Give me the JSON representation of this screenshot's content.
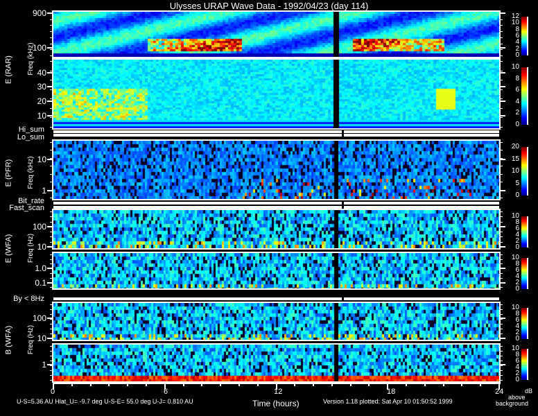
{
  "chart_data": {
    "type": "heatmap",
    "title": "Ulysses URAP Wave Data - 1992/04/23  (day 114)",
    "xlabel": "Time (hours)",
    "xlim": [
      0,
      24
    ],
    "xticks": [
      "0",
      "6",
      "12",
      "18",
      "24"
    ],
    "colorbar_label": [
      "dB",
      "above",
      "background"
    ],
    "colormap": "jet",
    "panels": [
      {
        "id": "rar-high",
        "group_label": "E (RAR)",
        "ylabel": "Freq (kHz)",
        "yscale": "log",
        "ylim": [
          56,
          1000
        ],
        "yticks": [
          {
            "value": 900,
            "label": "900"
          },
          {
            "value": 100,
            "label": "100"
          }
        ],
        "colorbar": {
          "range": [
            0,
            12
          ],
          "ticks": [
            "12",
            "10",
            "8",
            "6",
            "4",
            "2",
            "0"
          ]
        }
      },
      {
        "id": "rar-low",
        "group_label": "",
        "ylabel": "",
        "yscale": "linear",
        "ylim": [
          1.3,
          49
        ],
        "yticks": [
          {
            "value": 40,
            "label": "40"
          },
          {
            "value": 30,
            "label": "30"
          },
          {
            "value": 20,
            "label": "20"
          },
          {
            "value": 10,
            "label": "10"
          }
        ],
        "colorbar": {
          "range": [
            0,
            10
          ],
          "ticks": [
            "10",
            "8",
            "6",
            "4",
            "2",
            "0"
          ]
        }
      },
      {
        "id": "pfr",
        "group_label": "E (PFR)",
        "ylabel": "Freq (kHz)",
        "yscale": "log",
        "ylim": [
          0.54,
          40
        ],
        "yticks": [
          {
            "value": 10,
            "label": "10"
          },
          {
            "value": 1,
            "label": "1"
          }
        ],
        "colorbar": {
          "range": [
            0,
            20
          ],
          "ticks": [
            "20",
            "15",
            "10",
            "5",
            "0"
          ]
        }
      },
      {
        "id": "e-wfa-high",
        "group_label": "E (WFA)",
        "ylabel": "Freq (Hz)",
        "yscale": "log",
        "ylim": [
          8.5,
          670
        ],
        "yticks": [
          {
            "value": 100,
            "label": "100"
          },
          {
            "value": 10,
            "label": "10"
          }
        ],
        "colorbar": {
          "range": [
            0,
            10
          ],
          "ticks": [
            "10",
            "8",
            "6",
            "4",
            "2",
            "0"
          ]
        }
      },
      {
        "id": "e-wfa-low",
        "group_label": "",
        "ylabel": "",
        "yscale": "log",
        "ylim": [
          0.042,
          11
        ],
        "yticks": [
          {
            "value": 1.0,
            "label": "1.0"
          },
          {
            "value": 0.1,
            "label": "0.1"
          }
        ],
        "colorbar": {
          "range": [
            0,
            10
          ],
          "ticks": [
            "10",
            "8",
            "6",
            "4",
            "2",
            "0"
          ]
        }
      },
      {
        "id": "b-wfa-high",
        "group_label": "B (WFA)",
        "ylabel": "Freq (Hz)",
        "yscale": "log",
        "ylim": [
          8.5,
          574
        ],
        "yticks": [
          {
            "value": 100,
            "label": "100"
          },
          {
            "value": 10,
            "label": "10"
          }
        ],
        "colorbar": {
          "range": [
            0,
            10
          ],
          "ticks": [
            "10",
            "8",
            "6",
            "4",
            "2",
            "0"
          ]
        }
      },
      {
        "id": "b-wfa-low",
        "group_label": "",
        "ylabel": "",
        "yscale": "log",
        "ylim": [
          0.16,
          9
        ],
        "yticks": [
          {
            "value": 1,
            "label": "1"
          }
        ],
        "colorbar": {
          "range": [
            0,
            10
          ],
          "ticks": [
            "10",
            "8",
            "6",
            "4",
            "2",
            "0"
          ]
        }
      }
    ],
    "status_bars": {
      "hi_sum": "Hi_sum",
      "lo_sum": "Lo_sum",
      "bit_rate": "Bit_rate",
      "fast_scan": "Fast_scan",
      "by_lt_8hz": "By < 8Hz"
    }
  },
  "footer": {
    "ephemeris": "U-S=5.36 AU   Hlat_U= -9.7 deg   U-S-E= 55.0 deg   U-J= 0.810 AU",
    "version": "Version 1.18 plotted: Sat Apr 10 01:50:52 1999"
  }
}
